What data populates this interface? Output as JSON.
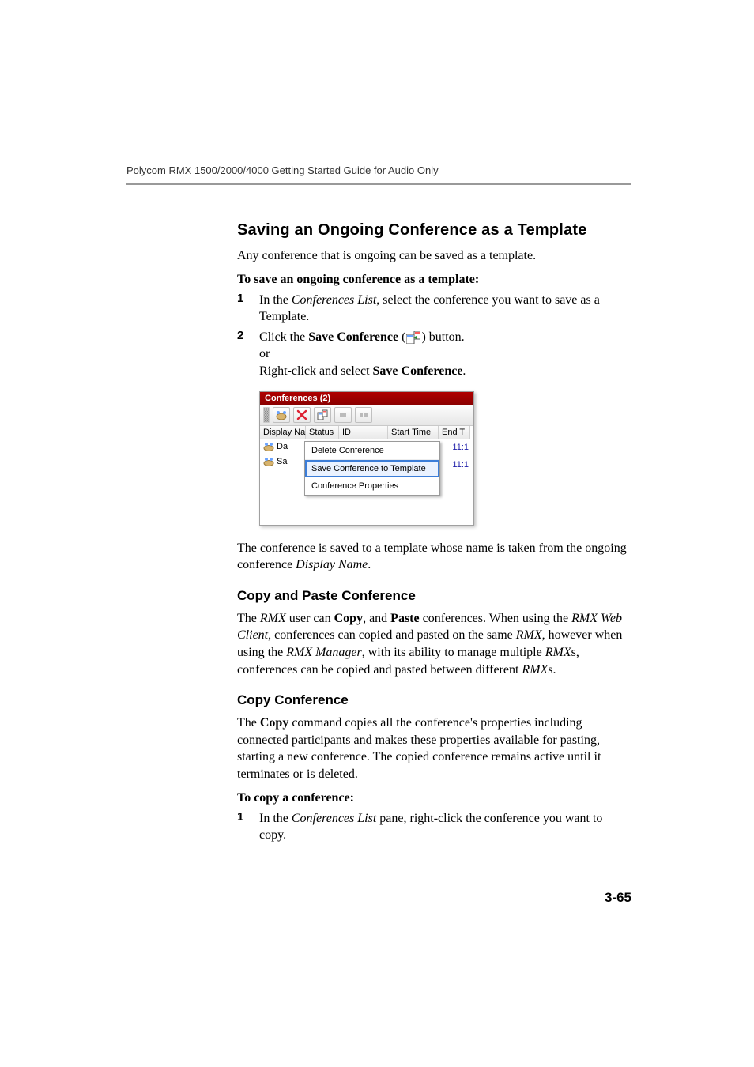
{
  "header": {
    "running_head": "Polycom RMX 1500/2000/4000 Getting Started Guide for Audio Only"
  },
  "s1": {
    "title": "Saving an Ongoing Conference as a Template",
    "intro": "Any conference that is ongoing can be saved as a template.",
    "how_to": "To save an ongoing conference as a template:",
    "step1_pre": "In the ",
    "step1_em": "Conferences List",
    "step1_post": ", select the conference you want to save as a Template.",
    "step2_a": "Click the ",
    "step2_b": "Save Conference",
    "step2_c": " (",
    "step2_d": ") button.",
    "step2_or": "or",
    "step2_e": "Right-click and select ",
    "step2_f": "Save Conference",
    "step2_g": ".",
    "after_a": "The conference is saved to a template whose name is taken from the ongoing conference ",
    "after_em": "Display Name",
    "after_b": "."
  },
  "shot": {
    "title": "Conferences (2)",
    "cols": [
      "Display Na",
      "Status",
      "ID",
      "Start Time",
      "End T"
    ],
    "rows": [
      {
        "name": "Da",
        "end": "11:1"
      },
      {
        "name": "Sa",
        "end": "11:1"
      }
    ],
    "menu": [
      "Delete Conference",
      "Save Conference to Template",
      "Conference Properties"
    ]
  },
  "s2": {
    "title": "Copy and Paste Conference",
    "p_a": "The ",
    "p_b": "RMX",
    "p_c": " user can ",
    "p_d": "Copy",
    "p_e": ", and ",
    "p_f": "Paste",
    "p_g": " conferences. When using the ",
    "p_h": "RMX Web Client",
    "p_i": ", conferences can copied and pasted on the same ",
    "p_j": "RMX,",
    "p_k": " however when using the ",
    "p_l": "RMX Manager",
    "p_m": ", with its ability to manage multiple ",
    "p_n": "RMX",
    "p_o": "s, conferences can be copied and pasted between different ",
    "p_p": "RMX",
    "p_q": "s."
  },
  "s3": {
    "title": "Copy Conference",
    "p_a": "The ",
    "p_b": "Copy",
    "p_c": " command copies all the conference's properties including connected participants and makes these properties available for pasting, starting a new conference. The copied conference remains active until it terminates or is deleted.",
    "how_to": "To copy a conference:",
    "step1_a": "In the ",
    "step1_b": "Conferences List",
    "step1_c": " pane, right-click the conference you want to copy."
  },
  "page_number": "3-65"
}
